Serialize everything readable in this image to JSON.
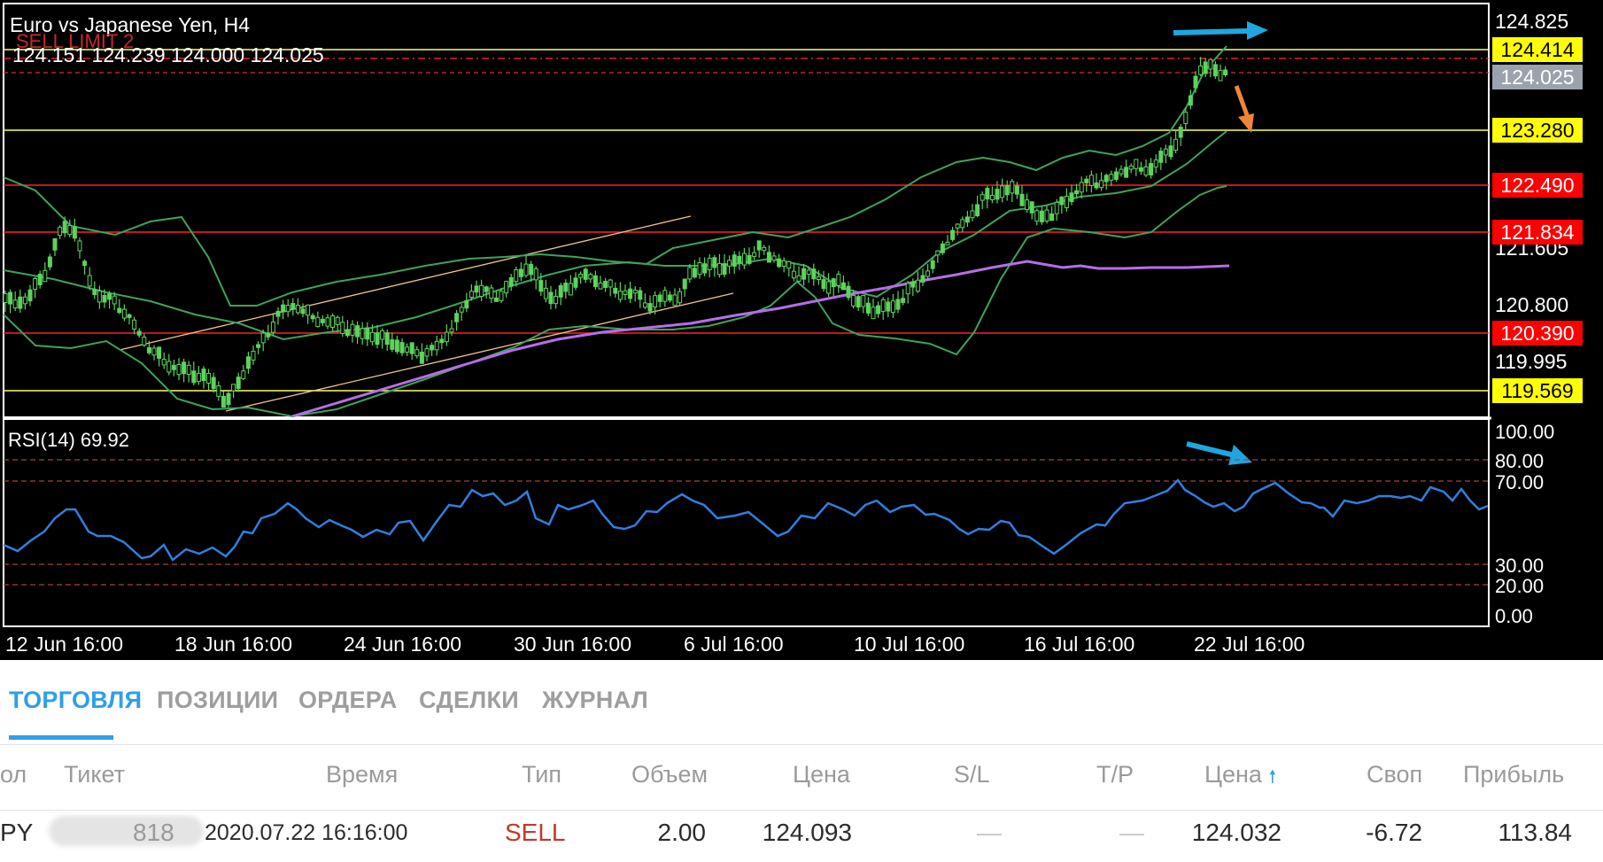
{
  "chart": {
    "title": "Euro vs Japanese Yen, H4",
    "ohlc_text": "124.151 124.239 124.000 124.025",
    "overlay_text": "SELL LIMIT 2",
    "price_axis_labels": [
      "124.825",
      "121.605",
      "120.800",
      "119.995"
    ],
    "level_tags": [
      {
        "label": "124.414",
        "bg": "#ffff00",
        "fg": "#000000"
      },
      {
        "label": "124.025",
        "bg": "#9aa3ad",
        "fg": "#ffffff"
      },
      {
        "label": "123.280",
        "bg": "#ffff00",
        "fg": "#000000"
      },
      {
        "label": "122.490",
        "bg": "#ff0000",
        "fg": "#ffffff"
      },
      {
        "label": "121.834",
        "bg": "#ff0000",
        "fg": "#ffffff"
      },
      {
        "label": "120.390",
        "bg": "#ff0000",
        "fg": "#ffffff"
      },
      {
        "label": "119.569",
        "bg": "#ffff00",
        "fg": "#000000"
      }
    ],
    "rsi_label": "RSI(14) 69.92",
    "rsi_axis_labels": [
      "100.00",
      "80.00",
      "70.00",
      "30.00",
      "20.00",
      "0.00"
    ],
    "time_labels": [
      "12 Jun 16:00",
      "18 Jun 16:00",
      "24 Jun 16:00",
      "30 Jun 16:00",
      "6 Jul 16:00",
      "10 Jul 16:00",
      "16 Jul 16:00",
      "22 Jul 16:00"
    ],
    "colors": {
      "candle": "#5dd35d",
      "band": "#3fa35a",
      "ma": "#b66ee8",
      "channel": "#f0c38a",
      "rsi": "#2f7fe0",
      "arrow_up": "#1fa6e0",
      "arrow_down": "#f0853a"
    }
  },
  "tabs": [
    {
      "label": "ТОРГОВЛЯ",
      "active": true
    },
    {
      "label": "ПОЗИЦИИ"
    },
    {
      "label": "ОРДЕРА"
    },
    {
      "label": "СДЕЛКИ"
    },
    {
      "label": "ЖУРНАЛ"
    }
  ],
  "table": {
    "headers": [
      "ол",
      "Тикет",
      "Время",
      "Тип",
      "Объем",
      "Цена",
      "S/L",
      "T/P",
      "Цена",
      "Своп",
      "Прибыль"
    ],
    "sort_icon": "arrow-up-icon",
    "row": {
      "symbol": "PY",
      "ticket_masked": "818",
      "time": "2020.07.22 16:16:00",
      "type": "SELL",
      "volume": "2.00",
      "open_price": "124.093",
      "sl": "—",
      "tp": "—",
      "current_price": "124.032",
      "swap": "-6.72",
      "profit": "113.84"
    }
  }
}
